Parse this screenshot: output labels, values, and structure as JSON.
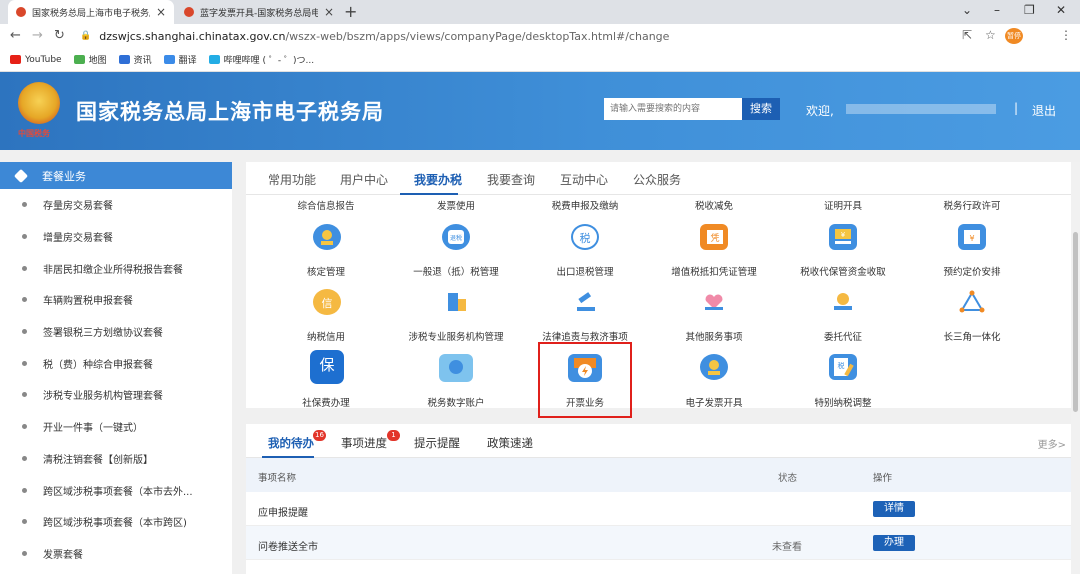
{
  "browser": {
    "tabs": [
      {
        "title": "国家税务总局上海市电子税务局",
        "active": true
      },
      {
        "title": "蓝字发票开具-国家税务总局电子",
        "active": false
      }
    ],
    "new_tab": "+",
    "url_host": "dzswjcs.shanghai.chinatax.gov.cn",
    "url_path": "/wszx-web/bszm/apps/views/companyPage/desktopTax.html#/change",
    "profile_label": "暂停",
    "bookmarks": [
      "YouTube",
      "地图",
      "资讯",
      "翻译",
      "哔哩哔哩 ( ゜- ゜)つ..."
    ]
  },
  "site": {
    "emblem_sub": "中国税务",
    "title": "国家税务总局上海市电子税务局",
    "search_placeholder": "请输入需要搜索的内容",
    "search_button": "搜索",
    "welcome": "欢迎,",
    "separator": "|",
    "logout": "退出"
  },
  "sidebar": {
    "header": "套餐业务",
    "items": [
      "存量房交易套餐",
      "增量房交易套餐",
      "非居民扣缴企业所得税报告套餐",
      "车辆购置税申报套餐",
      "签署银税三方划缴协议套餐",
      "税（费）种综合申报套餐",
      "涉税专业服务机构管理套餐",
      "开业一件事（一键式）",
      "清税注销套餐【创新版】",
      "跨区域涉税事项套餐（本市去外...",
      "跨区域涉税事项套餐（本市跨区)",
      "发票套餐"
    ]
  },
  "panel": {
    "tabs": [
      "常用功能",
      "用户中心",
      "我要办税",
      "我要查询",
      "互动中心",
      "公众服务"
    ],
    "active_tab": "我要办税",
    "top_labels": [
      "综合信息报告",
      "发票使用",
      "税费申报及缴纳",
      "税收减免",
      "证明开具",
      "税务行政许可"
    ],
    "row1": [
      "核定管理",
      "一般退（抵）税管理",
      "出口退税管理",
      "增值税抵扣凭证管理",
      "税收代保管资金收取",
      "预约定价安排"
    ],
    "row2": [
      "纳税信用",
      "涉税专业服务机构管理",
      "法律追责与救济事项",
      "其他服务事项",
      "委托代征",
      "长三角一体化"
    ],
    "row3": [
      "社保费办理",
      "税务数字账户",
      "开票业务",
      "电子发票开具",
      "特别纳税调整"
    ],
    "icon_glyphs": {
      "tax_refund": "退税",
      "tax": "税",
      "voucher": "凭",
      "yuan": "¥",
      "credit": "信",
      "social": "保",
      "special": "税"
    },
    "highlighted": "开票业务",
    "highlight_color": "#e0201b"
  },
  "todo": {
    "tabs": [
      {
        "label": "我的待办",
        "badge": "16"
      },
      {
        "label": "事项进度",
        "badge": "1"
      },
      {
        "label": "提示提醒",
        "badge": ""
      },
      {
        "label": "政策速递",
        "badge": ""
      }
    ],
    "more": "更多>",
    "headers": {
      "name": "事项名称",
      "status": "状态",
      "op": "操作"
    },
    "rows": [
      {
        "name": "应申报提醒",
        "status": "",
        "op": "详情"
      },
      {
        "name": "问卷推送全市",
        "status": "未查看",
        "op": "办理"
      }
    ]
  },
  "colors": {
    "brand_blue": "#2d74bf",
    "accent": "#1d5fb3",
    "badge_red": "#e2352a"
  }
}
